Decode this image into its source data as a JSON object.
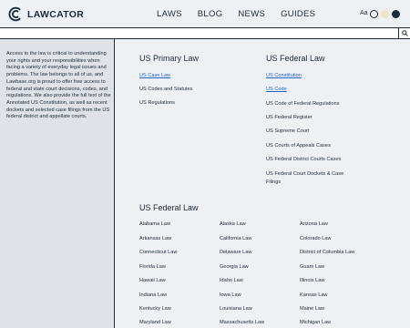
{
  "header": {
    "logo_text": "LAWCATOR",
    "nav": [
      "LAWS",
      "BLOG",
      "NEWS",
      "GUIDES"
    ],
    "font_size_label": "Aa",
    "themes": [
      {
        "name": "light",
        "color": "#eef1f4"
      },
      {
        "name": "sepia",
        "color": "#efe4c6"
      },
      {
        "name": "dark",
        "color": "#1e2a37"
      }
    ]
  },
  "search": {
    "placeholder": "",
    "value": ""
  },
  "sidebar": {
    "description": "Access to the law is critical to understanding your rights and your responsibilities when facing a variety of everyday legal issues and problems. The law belongs to all of us, and Lawbase.org is proud to offer free access to federal and state court decisions, codes, and regulations. We also provide the full text of the Annotated US Constitution, as well as recent dockets and selected case filings from the US federal district and appellate courts."
  },
  "primary_law": {
    "title": "US Primary Law",
    "links": [
      "US Case Law",
      "US Codes and Statutes",
      "US Regulations"
    ]
  },
  "federal_law": {
    "title": "US Federal Law",
    "links": [
      "US Constitution",
      "US Code",
      "US Code of Federal Regulations",
      "US Federal Register",
      "US Supreme Court",
      "US Courts of Appeals Cases",
      "US Federal District Courts Cases",
      "US Federal Court Dockets & Case Filings"
    ]
  },
  "states_section": {
    "title": "US Federal Law",
    "col1": [
      "Alabama Law",
      "Arkansas Law",
      "Connecticut Law",
      "Florida Law",
      "Hawaii Law",
      "Indiana Law",
      "Kentucky Law",
      "Maryland Law"
    ],
    "col2": [
      "Alaska Law",
      "California Law",
      "Delaware Law",
      "Georgia Law",
      "Idaho Law",
      "Iowa Law",
      "Louisiana Law",
      "Massachusetts Law"
    ],
    "col3": [
      "Arizona Law",
      "Colorado Law",
      "District of Columbia Law",
      "Guam Law",
      "Illinois Law",
      "Kansas Law",
      "Maine Law",
      "Michigan Law"
    ]
  },
  "colors": {
    "text": "#1e2a37",
    "link_active": "#2563c4",
    "background": "#eef1f4",
    "sidebar": "#dfe3e8"
  }
}
